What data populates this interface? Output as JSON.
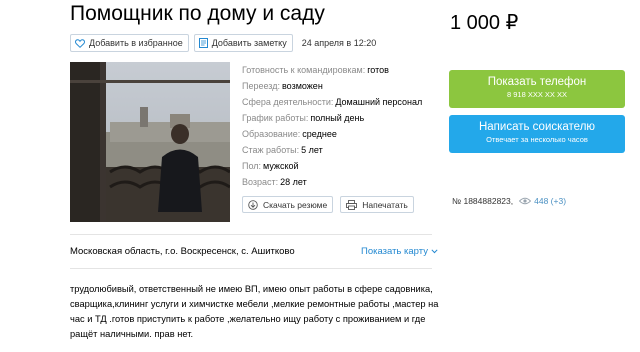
{
  "title": "Помощник по дому и саду",
  "actions": {
    "favorite_label": "Добавить в избранное",
    "note_label": "Добавить заметку",
    "date": "24 апреля в 12:20"
  },
  "price": "1 000 ₽",
  "details": [
    {
      "label": "Готовность к командировкам:",
      "value": "готов"
    },
    {
      "label": "Переезд:",
      "value": "возможен"
    },
    {
      "label": "Сфера деятельности:",
      "value": "Домашний персонал"
    },
    {
      "label": "График работы:",
      "value": "полный день"
    },
    {
      "label": "Образование:",
      "value": "среднее"
    },
    {
      "label": "Стаж работы:",
      "value": "5 лет"
    },
    {
      "label": "Пол:",
      "value": "мужской"
    },
    {
      "label": "Возраст:",
      "value": "28 лет"
    }
  ],
  "resume_actions": {
    "download_label": "Скачать резюме",
    "print_label": "Напечатать"
  },
  "contact": {
    "phone_label": "Показать телефон",
    "phone_number": "8 918 XXX XX XX",
    "write_label": "Написать соискателю",
    "write_sub": "Отвечает за несколько часов"
  },
  "meta": {
    "ad_number": "№ 1884882823,",
    "views": "448 (+3)"
  },
  "location": {
    "address": "Московская область, г.о. Воскресенск, с. Ашитково",
    "show_map_label": "Показать карту"
  },
  "description": "трудолюбивый, ответственный не имею ВП, имею опыт работы в сфере садовника, сварщика,клининг услуги и химчистке мебели ,мелкие ремонтные работы ,мастер на час и ТД .готов приступить к работе ,желательно ищу работу с проживанием и где ращёт наличными. прав нет.",
  "colors": {
    "phone_button": "#8cc63f",
    "write_button": "#23a8ea",
    "link": "#2489d1"
  }
}
